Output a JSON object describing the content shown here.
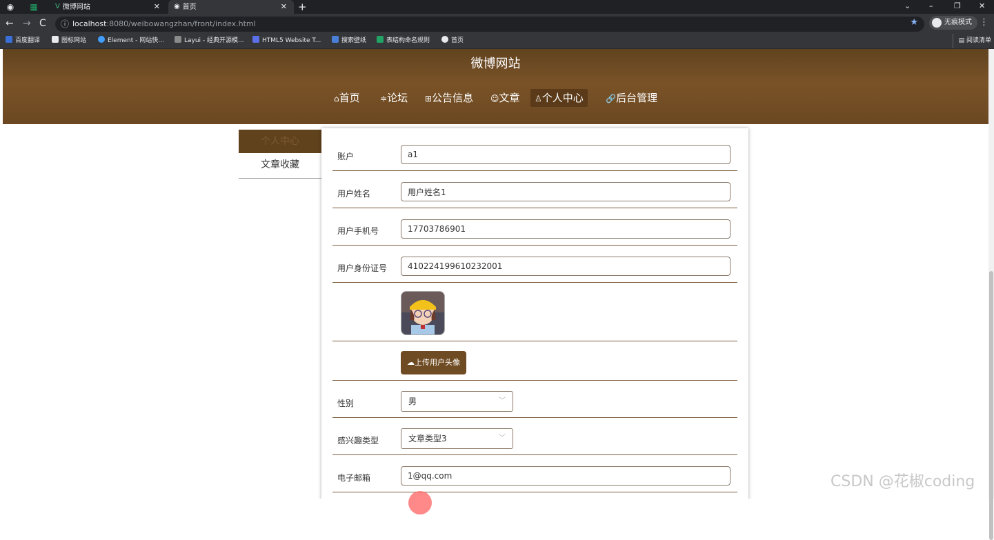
{
  "browser": {
    "tabs": [
      {
        "title": "微博网站"
      },
      {
        "title": "首页"
      }
    ],
    "url_host": "localhost",
    "url_rest": ":8080/weibowangzhan/front/index.html",
    "incognito_label": "无痕模式",
    "bookmarks": [
      {
        "label": "百度翻译",
        "color": "#3b6fd8"
      },
      {
        "label": "图标网站",
        "color": "#e8eaed"
      },
      {
        "label": "Element - 网站快...",
        "color": "#409eff"
      },
      {
        "label": "Layui - 经典开源模...",
        "color": "#8a8a8a"
      },
      {
        "label": "HTML5 Website T...",
        "color": "#5b6fe8"
      },
      {
        "label": "搜索壁纸",
        "color": "#4a7fd8"
      },
      {
        "label": "表结构命名规则",
        "color": "#21a366"
      },
      {
        "label": "首页",
        "color": "#e8eaed"
      }
    ],
    "reading_list": "阅读清单"
  },
  "site": {
    "title": "微博网站",
    "nav": [
      {
        "icon": "⌂",
        "label": "首页"
      },
      {
        "icon": "≑",
        "label": "论坛"
      },
      {
        "icon": "⊞",
        "label": "公告信息"
      },
      {
        "icon": "☺",
        "label": "文章"
      },
      {
        "icon": "♙",
        "label": "个人中心"
      },
      {
        "icon": "🔗",
        "label": "后台管理"
      }
    ],
    "active_nav": "个人中心"
  },
  "sidebar": {
    "items": [
      {
        "label": "个人中心"
      },
      {
        "label": "文章收藏"
      }
    ]
  },
  "form": {
    "account": {
      "label": "账户",
      "value": "a1"
    },
    "name": {
      "label": "用户姓名",
      "value": "用户姓名1"
    },
    "phone": {
      "label": "用户手机号",
      "value": "17703786901"
    },
    "idcard": {
      "label": "用户身份证号",
      "value": "410224199610232001"
    },
    "upload_label": "上传用户头像",
    "gender": {
      "label": "性别",
      "value": "男"
    },
    "interest": {
      "label": "感兴趣类型",
      "value": "文章类型3"
    },
    "email": {
      "label": "电子邮箱",
      "value": "1@qq.com"
    }
  },
  "watermark": "CSDN @花椒coding",
  "colors": {
    "header_brown": "#6b4822",
    "accent_brown": "#6f4b23",
    "browser_dark": "#202124"
  }
}
